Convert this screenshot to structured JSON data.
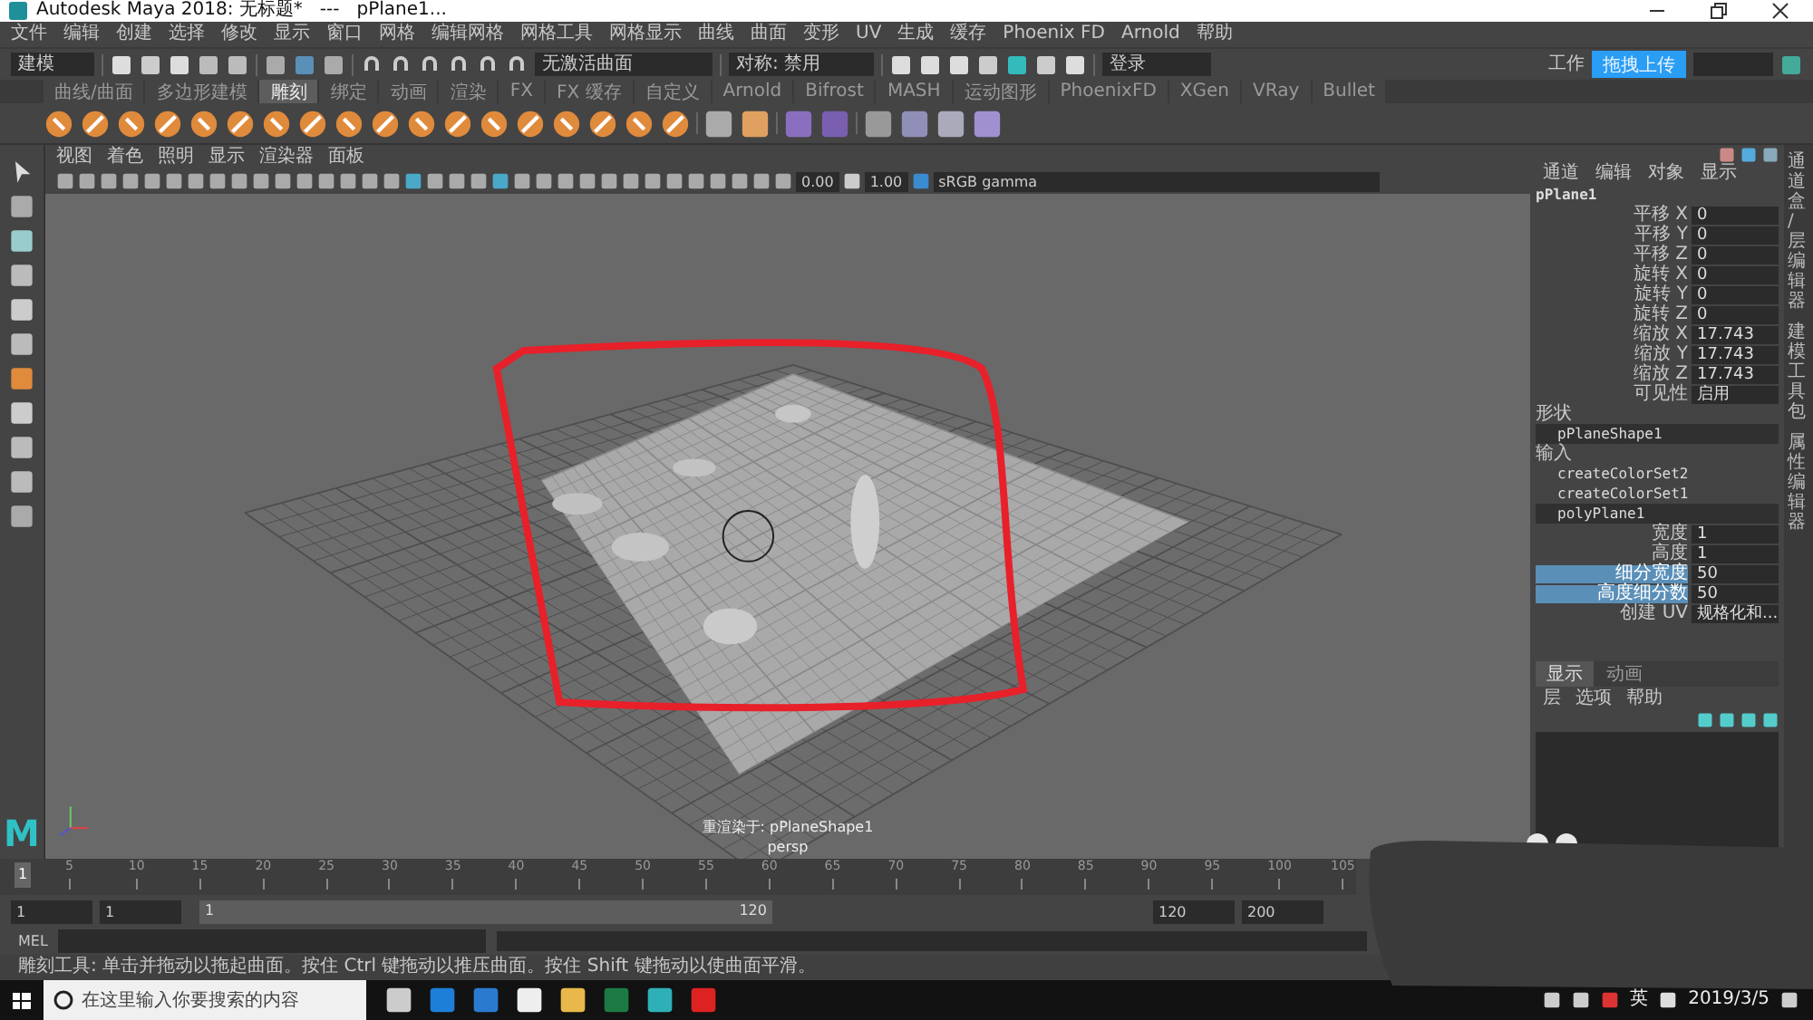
{
  "window": {
    "title": "Autodesk Maya 2018: 无标题*   ---   pPlane1..."
  },
  "menu_bar": [
    "文件",
    "编辑",
    "创建",
    "选择",
    "修改",
    "显示",
    "窗口",
    "网格",
    "编辑网格",
    "网格工具",
    "网格显示",
    "曲线",
    "曲面",
    "变形",
    "UV",
    "生成",
    "缓存",
    "Phoenix FD",
    "Arnold",
    "帮助"
  ],
  "status_line": {
    "mode": "建模",
    "surface_field": "无激活曲面",
    "symmetry": "对称: 禁用",
    "login": "登录",
    "workspace_label": "工作",
    "upload_badge": "拖拽上传"
  },
  "shelf_tabs": [
    {
      "label": "曲线/曲面",
      "selected": false
    },
    {
      "label": "多边形建模",
      "selected": false
    },
    {
      "label": "雕刻",
      "selected": true
    },
    {
      "label": "绑定",
      "selected": false
    },
    {
      "label": "动画",
      "selected": false
    },
    {
      "label": "渲染",
      "selected": false
    },
    {
      "label": "FX",
      "selected": false
    },
    {
      "label": "FX 缓存",
      "selected": false
    },
    {
      "label": "自定义",
      "selected": false
    },
    {
      "label": "Arnold",
      "selected": false
    },
    {
      "label": "Bifrost",
      "selected": false
    },
    {
      "label": "MASH",
      "selected": false
    },
    {
      "label": "运动图形",
      "selected": false
    },
    {
      "label": "PhoenixFD",
      "selected": false
    },
    {
      "label": "XGen",
      "selected": false
    },
    {
      "label": "VRay",
      "selected": false
    },
    {
      "label": "Bullet",
      "selected": false
    }
  ],
  "toolbox": {
    "logo": "M"
  },
  "viewport": {
    "menus": [
      "视图",
      "着色",
      "照明",
      "显示",
      "渲染器",
      "面板"
    ],
    "exposure": "0.00",
    "gamma": "1.00",
    "color_space": "sRGB gamma",
    "hud_label": "重渲染于: pPlaneShape1",
    "camera": "persp"
  },
  "channel_box": {
    "tabs": [
      "通道",
      "编辑",
      "对象",
      "显示"
    ],
    "object": "pPlane1",
    "attributes": [
      {
        "name": "平移 X",
        "value": "0"
      },
      {
        "name": "平移 Y",
        "value": "0"
      },
      {
        "name": "平移 Z",
        "value": "0"
      },
      {
        "name": "旋转 X",
        "value": "0"
      },
      {
        "name": "旋转 Y",
        "value": "0"
      },
      {
        "name": "旋转 Z",
        "value": "0"
      },
      {
        "name": "缩放 X",
        "value": "17.743"
      },
      {
        "name": "缩放 Y",
        "value": "17.743"
      },
      {
        "name": "缩放 Z",
        "value": "17.743"
      },
      {
        "name": "可见性",
        "value": "启用"
      }
    ],
    "shapes_header": "形状",
    "shape": "pPlaneShape1",
    "inputs_header": "输入",
    "inputs": [
      {
        "name": "createColorSet2",
        "selected": false
      },
      {
        "name": "createColorSet1",
        "selected": false
      },
      {
        "name": "polyPlane1",
        "selected": true
      }
    ],
    "input_attributes": [
      {
        "name": "宽度",
        "value": "1",
        "selected": false
      },
      {
        "name": "高度",
        "value": "1",
        "selected": false
      },
      {
        "name": "细分宽度",
        "value": "50",
        "selected": true
      },
      {
        "name": "高度细分数",
        "value": "50",
        "selected": true
      },
      {
        "name": "创建 UV",
        "value": "规格化和...",
        "selected": false
      }
    ]
  },
  "side_tabs": [
    "通道盒/层编辑器",
    "建模工具包",
    "属性编辑器"
  ],
  "layer_editor": {
    "tabs": [
      {
        "label": "显示",
        "selected": true
      },
      {
        "label": "动画",
        "selected": false
      }
    ],
    "menus": [
      "层",
      "选项",
      "帮助"
    ]
  },
  "time_slider": {
    "current_frame": "1",
    "level": 0,
    "ticks": [
      "5",
      "10",
      "15",
      "20",
      "25",
      "30",
      "35",
      "40",
      "45",
      "50",
      "55",
      "60",
      "65",
      "70",
      "75",
      "80",
      "85",
      "90",
      "95",
      "100",
      "105"
    ]
  },
  "range_slider": {
    "start": "1",
    "playback_start": "1",
    "range_start": "1",
    "range_end": "120",
    "playback_end": "120",
    "end": "200"
  },
  "command_line": {
    "label": "MEL"
  },
  "help_line": "雕刻工具: 单击并拖动以拖起曲面。按住 Ctrl 键拖动以推压曲面。按住 Shift 键拖动以使曲面平滑。",
  "taskbar": {
    "search_placeholder": "在这里输入你要搜索的内容",
    "language": "英",
    "date": "2019/3/5"
  }
}
